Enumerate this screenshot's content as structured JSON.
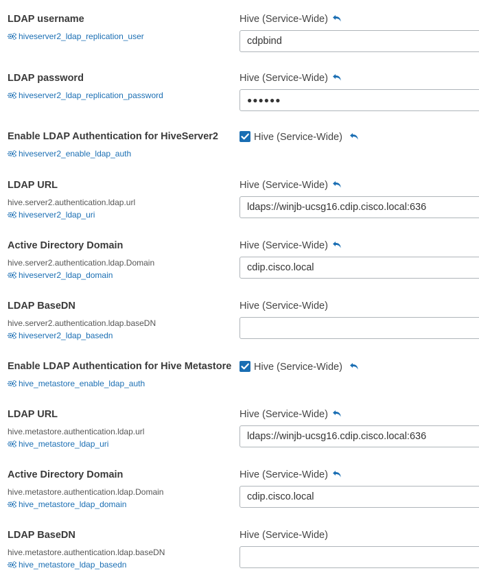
{
  "settings": [
    {
      "label": "LDAP username",
      "property": "",
      "config_name": "hiveserver2_ldap_replication_user",
      "scope": "Hive (Service-Wide)",
      "undo": true,
      "type": "text",
      "value": "cdpbind"
    },
    {
      "label": "LDAP password",
      "property": "",
      "config_name": "hiveserver2_ldap_replication_password",
      "scope": "Hive (Service-Wide)",
      "undo": true,
      "type": "password",
      "value": "●●●●●●"
    },
    {
      "label": "Enable LDAP Authentication for HiveServer2",
      "property": "",
      "config_name": "hiveserver2_enable_ldap_auth",
      "scope": "Hive (Service-Wide)",
      "undo": true,
      "type": "checkbox",
      "checked": true
    },
    {
      "label": "LDAP URL",
      "property": "hive.server2.authentication.ldap.url",
      "config_name": "hiveserver2_ldap_uri",
      "scope": "Hive (Service-Wide)",
      "undo": true,
      "type": "text",
      "value": "ldaps://winjb-ucsg16.cdip.cisco.local:636"
    },
    {
      "label": "Active Directory Domain",
      "property": "hive.server2.authentication.ldap.Domain",
      "config_name": "hiveserver2_ldap_domain",
      "scope": "Hive (Service-Wide)",
      "undo": true,
      "type": "text",
      "value": "cdip.cisco.local"
    },
    {
      "label": "LDAP BaseDN",
      "property": "hive.server2.authentication.ldap.baseDN",
      "config_name": "hiveserver2_ldap_basedn",
      "scope": "Hive (Service-Wide)",
      "undo": false,
      "type": "text",
      "value": ""
    },
    {
      "label": "Enable LDAP Authentication for Hive Metastore",
      "property": "",
      "config_name": "hive_metastore_enable_ldap_auth",
      "scope": "Hive (Service-Wide)",
      "undo": true,
      "type": "checkbox",
      "checked": true
    },
    {
      "label": "LDAP URL",
      "property": "hive.metastore.authentication.ldap.url",
      "config_name": "hive_metastore_ldap_uri",
      "scope": "Hive (Service-Wide)",
      "undo": true,
      "type": "text",
      "value": "ldaps://winjb-ucsg16.cdip.cisco.local:636"
    },
    {
      "label": "Active Directory Domain",
      "property": "hive.metastore.authentication.ldap.Domain",
      "config_name": "hive_metastore_ldap_domain",
      "scope": "Hive (Service-Wide)",
      "undo": true,
      "type": "text",
      "value": "cdip.cisco.local"
    },
    {
      "label": "LDAP BaseDN",
      "property": "hive.metastore.authentication.ldap.baseDN",
      "config_name": "hive_metastore_ldap_basedn",
      "scope": "Hive (Service-Wide)",
      "undo": false,
      "type": "text",
      "value": ""
    }
  ],
  "icons": {
    "config": "gears-icon",
    "undo": "undo-arrow-icon",
    "check": "checkmark-icon"
  },
  "colors": {
    "link": "#1a6eb3",
    "checkbox": "#1a6eb3",
    "border": "#aeb4b9"
  }
}
